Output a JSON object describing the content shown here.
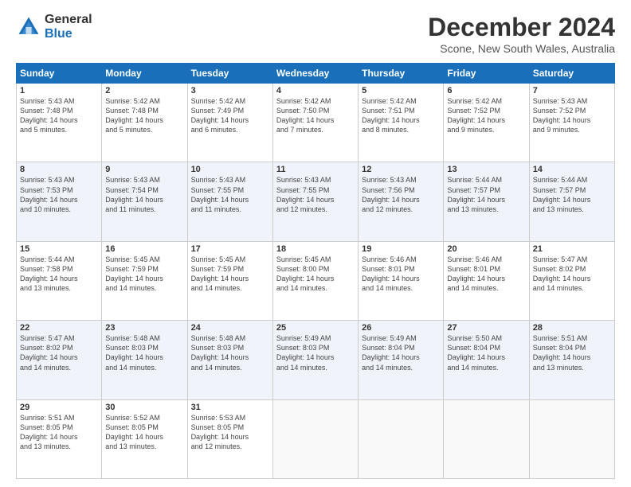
{
  "logo": {
    "general": "General",
    "blue": "Blue"
  },
  "title": "December 2024",
  "subtitle": "Scone, New South Wales, Australia",
  "days_header": [
    "Sunday",
    "Monday",
    "Tuesday",
    "Wednesday",
    "Thursday",
    "Friday",
    "Saturday"
  ],
  "weeks": [
    [
      {
        "day": "1",
        "sunrise": "5:43 AM",
        "sunset": "7:48 PM",
        "daylight": "14 hours and 5 minutes."
      },
      {
        "day": "2",
        "sunrise": "5:42 AM",
        "sunset": "7:48 PM",
        "daylight": "14 hours and 5 minutes."
      },
      {
        "day": "3",
        "sunrise": "5:42 AM",
        "sunset": "7:49 PM",
        "daylight": "14 hours and 6 minutes."
      },
      {
        "day": "4",
        "sunrise": "5:42 AM",
        "sunset": "7:50 PM",
        "daylight": "14 hours and 7 minutes."
      },
      {
        "day": "5",
        "sunrise": "5:42 AM",
        "sunset": "7:51 PM",
        "daylight": "14 hours and 8 minutes."
      },
      {
        "day": "6",
        "sunrise": "5:42 AM",
        "sunset": "7:52 PM",
        "daylight": "14 hours and 9 minutes."
      },
      {
        "day": "7",
        "sunrise": "5:43 AM",
        "sunset": "7:52 PM",
        "daylight": "14 hours and 9 minutes."
      }
    ],
    [
      {
        "day": "8",
        "sunrise": "5:43 AM",
        "sunset": "7:53 PM",
        "daylight": "14 hours and 10 minutes."
      },
      {
        "day": "9",
        "sunrise": "5:43 AM",
        "sunset": "7:54 PM",
        "daylight": "14 hours and 11 minutes."
      },
      {
        "day": "10",
        "sunrise": "5:43 AM",
        "sunset": "7:55 PM",
        "daylight": "14 hours and 11 minutes."
      },
      {
        "day": "11",
        "sunrise": "5:43 AM",
        "sunset": "7:55 PM",
        "daylight": "14 hours and 12 minutes."
      },
      {
        "day": "12",
        "sunrise": "5:43 AM",
        "sunset": "7:56 PM",
        "daylight": "14 hours and 12 minutes."
      },
      {
        "day": "13",
        "sunrise": "5:44 AM",
        "sunset": "7:57 PM",
        "daylight": "14 hours and 13 minutes."
      },
      {
        "day": "14",
        "sunrise": "5:44 AM",
        "sunset": "7:57 PM",
        "daylight": "14 hours and 13 minutes."
      }
    ],
    [
      {
        "day": "15",
        "sunrise": "5:44 AM",
        "sunset": "7:58 PM",
        "daylight": "14 hours and 13 minutes."
      },
      {
        "day": "16",
        "sunrise": "5:45 AM",
        "sunset": "7:59 PM",
        "daylight": "14 hours and 14 minutes."
      },
      {
        "day": "17",
        "sunrise": "5:45 AM",
        "sunset": "7:59 PM",
        "daylight": "14 hours and 14 minutes."
      },
      {
        "day": "18",
        "sunrise": "5:45 AM",
        "sunset": "8:00 PM",
        "daylight": "14 hours and 14 minutes."
      },
      {
        "day": "19",
        "sunrise": "5:46 AM",
        "sunset": "8:01 PM",
        "daylight": "14 hours and 14 minutes."
      },
      {
        "day": "20",
        "sunrise": "5:46 AM",
        "sunset": "8:01 PM",
        "daylight": "14 hours and 14 minutes."
      },
      {
        "day": "21",
        "sunrise": "5:47 AM",
        "sunset": "8:02 PM",
        "daylight": "14 hours and 14 minutes."
      }
    ],
    [
      {
        "day": "22",
        "sunrise": "5:47 AM",
        "sunset": "8:02 PM",
        "daylight": "14 hours and 14 minutes."
      },
      {
        "day": "23",
        "sunrise": "5:48 AM",
        "sunset": "8:03 PM",
        "daylight": "14 hours and 14 minutes."
      },
      {
        "day": "24",
        "sunrise": "5:48 AM",
        "sunset": "8:03 PM",
        "daylight": "14 hours and 14 minutes."
      },
      {
        "day": "25",
        "sunrise": "5:49 AM",
        "sunset": "8:03 PM",
        "daylight": "14 hours and 14 minutes."
      },
      {
        "day": "26",
        "sunrise": "5:49 AM",
        "sunset": "8:04 PM",
        "daylight": "14 hours and 14 minutes."
      },
      {
        "day": "27",
        "sunrise": "5:50 AM",
        "sunset": "8:04 PM",
        "daylight": "14 hours and 14 minutes."
      },
      {
        "day": "28",
        "sunrise": "5:51 AM",
        "sunset": "8:04 PM",
        "daylight": "14 hours and 13 minutes."
      }
    ],
    [
      {
        "day": "29",
        "sunrise": "5:51 AM",
        "sunset": "8:05 PM",
        "daylight": "14 hours and 13 minutes."
      },
      {
        "day": "30",
        "sunrise": "5:52 AM",
        "sunset": "8:05 PM",
        "daylight": "14 hours and 13 minutes."
      },
      {
        "day": "31",
        "sunrise": "5:53 AM",
        "sunset": "8:05 PM",
        "daylight": "14 hours and 12 minutes."
      },
      null,
      null,
      null,
      null
    ]
  ],
  "labels": {
    "sunrise": "Sunrise:",
    "sunset": "Sunset:",
    "daylight": "Daylight:"
  }
}
